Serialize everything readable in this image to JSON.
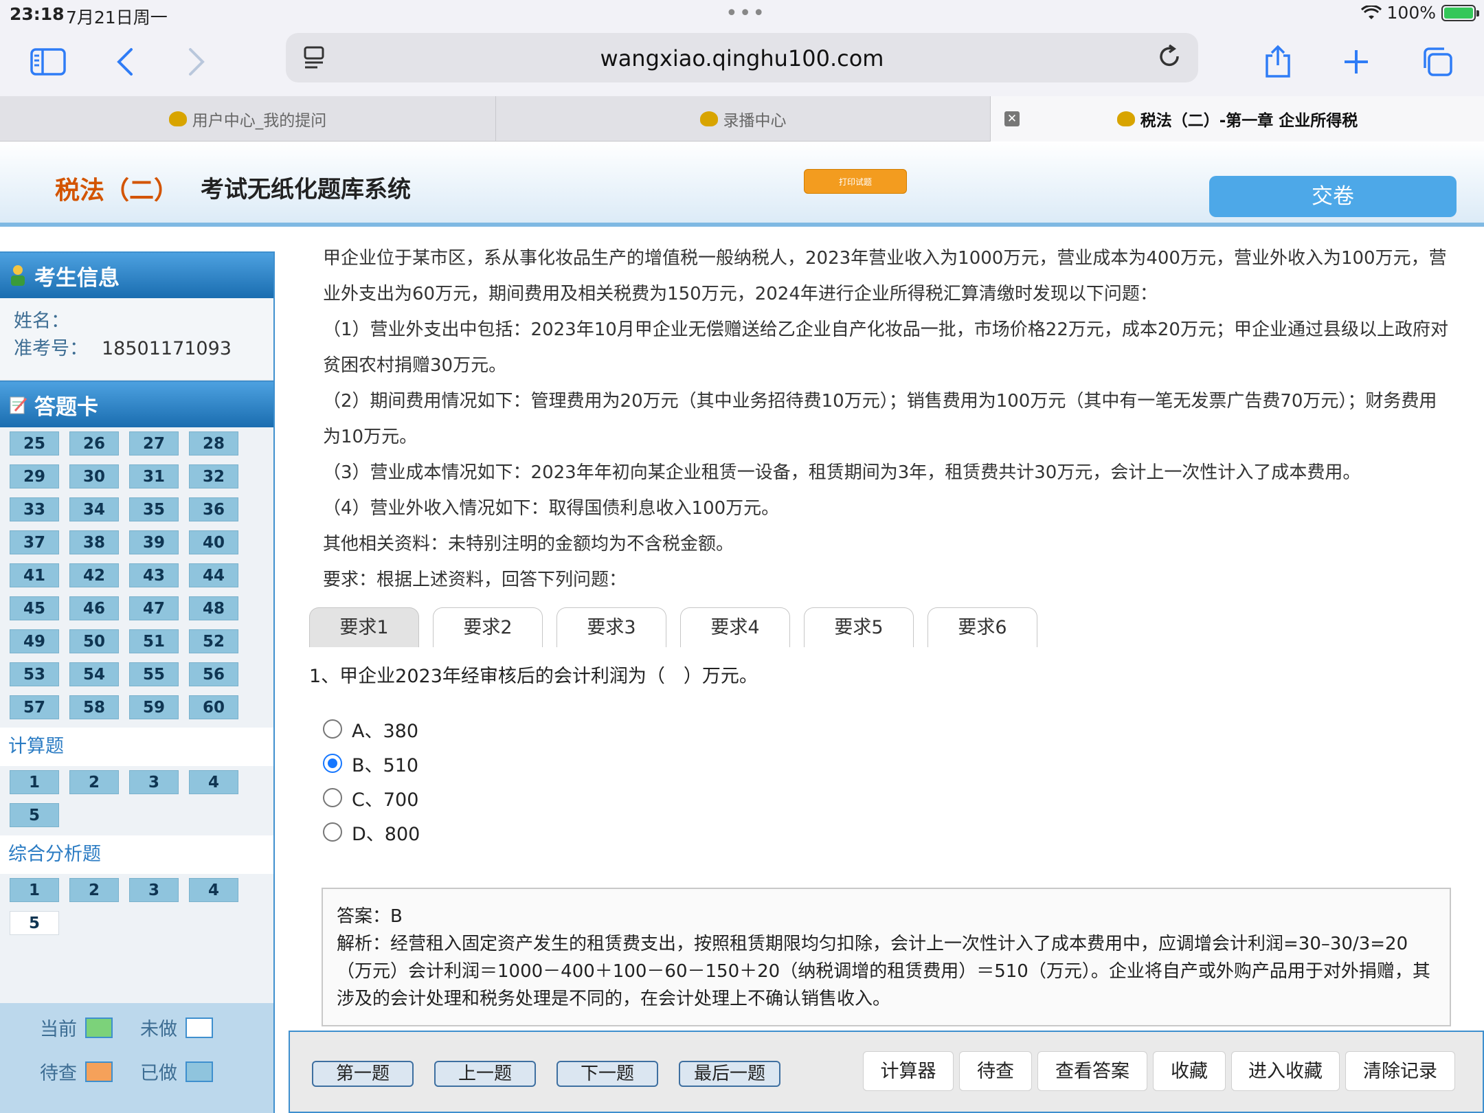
{
  "status": {
    "time": "23:18",
    "date": "7月21日周一",
    "battery": "100%",
    "dots": "•••"
  },
  "browser": {
    "url": "wangxiao.qinghu100.com",
    "tabs": [
      {
        "title": "用户中心_我的提问"
      },
      {
        "title": "录播中心"
      },
      {
        "title": "税法（二）-第一章 企业所得税"
      }
    ]
  },
  "header": {
    "brand_subject": "税法（二）",
    "brand_system": "考试无纸化题库系统",
    "print_label": "打印试题",
    "submit_label": "交卷"
  },
  "sidebar": {
    "info_title": "考生信息",
    "name_label": "姓名：",
    "name_value": "",
    "exam_no_label": "准考号：",
    "exam_no_value": "18501171093",
    "card_title": "答题卡",
    "objective_numbers": [
      "25",
      "26",
      "27",
      "28",
      "29",
      "30",
      "31",
      "32",
      "33",
      "34",
      "35",
      "36",
      "37",
      "38",
      "39",
      "40",
      "41",
      "42",
      "43",
      "44",
      "45",
      "46",
      "47",
      "48",
      "49",
      "50",
      "51",
      "52",
      "53",
      "54",
      "55",
      "56",
      "57",
      "58",
      "59",
      "60"
    ],
    "calc_title": "计算题",
    "calc_numbers": [
      "1",
      "2",
      "3",
      "4",
      "5"
    ],
    "comp_title": "综合分析题",
    "comp_numbers": [
      "1",
      "2",
      "3",
      "4",
      "5"
    ],
    "legend": {
      "current": "当前",
      "undone": "未做",
      "pending": "待查",
      "done": "已做"
    },
    "colors": {
      "current": "#7cd27a",
      "undone": "#ffffff",
      "pending": "#f5a15a",
      "done": "#8fc4dd"
    }
  },
  "question": {
    "paragraphs": [
      "甲企业位于某市区，系从事化妆品生产的增值税一般纳税人，2023年营业收入为1000万元，营业成本为400万元，营业外收入为100万元，营业外支出为60万元，期间费用及相关税费为150万元，2024年进行企业所得税汇算清缴时发现以下问题：",
      "（1）营业外支出中包括：2023年10月甲企业无偿赠送给乙企业自产化妆品一批，市场价格22万元，成本20万元；甲企业通过县级以上政府对贫困农村捐赠30万元。",
      "（2）期间费用情况如下：管理费用为20万元（其中业务招待费10万元）；销售费用为100万元（其中有一笔无发票广告费70万元）；财务费用为10万元。",
      "（3）营业成本情况如下：2023年年初向某企业租赁一设备，租赁期间为3年，租赁费共计30万元，会计上一次性计入了成本费用。",
      "（4）营业外收入情况如下：取得国债利息收入100万元。",
      "其他相关资料：未特别注明的金额均为不含税金额。",
      "要求：根据上述资料，回答下列问题："
    ],
    "req_tabs": [
      "要求1",
      "要求2",
      "要求3",
      "要求4",
      "要求5",
      "要求6"
    ],
    "stem": "1、甲企业2023年经审核后的会计利润为（　）万元。",
    "options": [
      "A、380",
      "B、510",
      "C、700",
      "D、800"
    ],
    "selected": "B、510",
    "answer": "答案：B",
    "analysis": "解析：经营租入固定资产发生的租赁费支出，按照租赁期限均匀扣除，会计上一次性计入了成本费用中，应调增会计利润=30–30/3=20（万元）会计利润＝1000－400＋100－60－150＋20（纳税调增的租赁费用）＝510（万元）。企业将自产或外购产品用于对外捐赠，其涉及的会计处理和税务处理是不同的，在会计处理上不确认销售收入。"
  },
  "bottom": {
    "nav": [
      "第一题",
      "上一题",
      "下一题",
      "最后一题"
    ],
    "tools": [
      "计算器",
      "待查",
      "查看答案",
      "收藏",
      "进入收藏",
      "清除记录"
    ]
  }
}
